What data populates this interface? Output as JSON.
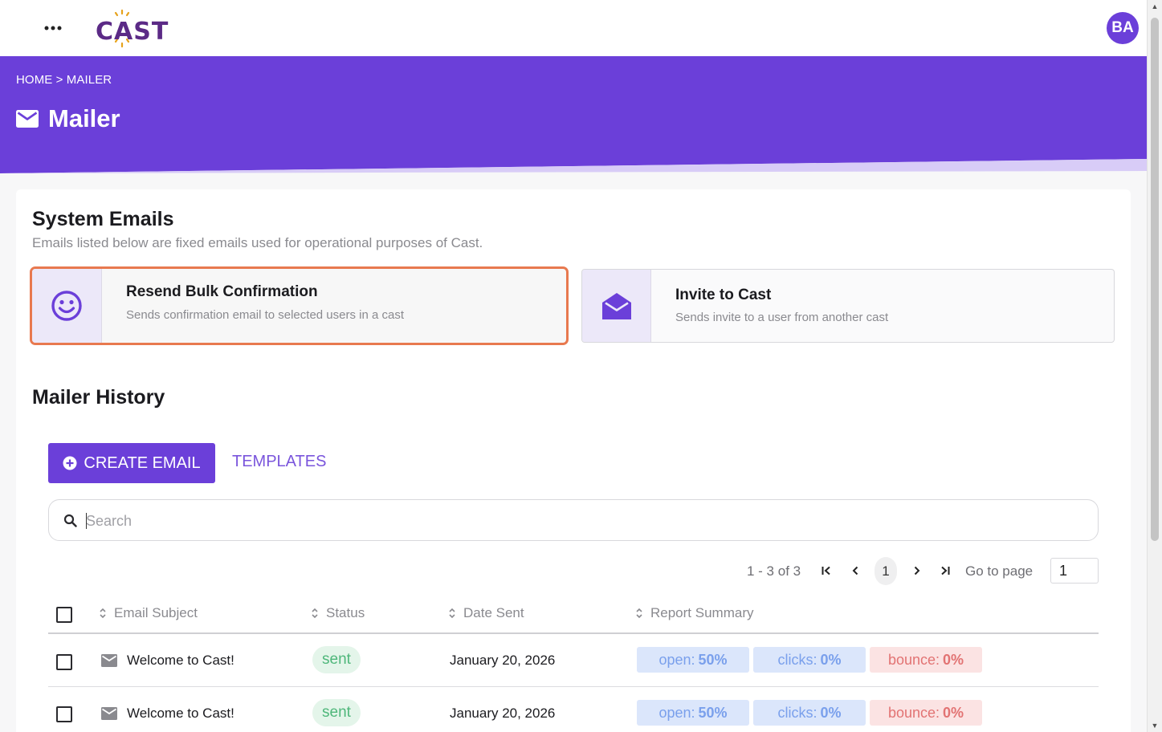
{
  "header": {
    "logo_text": "CAST",
    "avatar_initials": "BA"
  },
  "hero": {
    "breadcrumb": "HOME > MAILER",
    "title": "Mailer"
  },
  "system_emails": {
    "title": "System Emails",
    "subtitle": "Emails listed below are fixed emails used for operational purposes of Cast.",
    "cards": [
      {
        "title": "Resend Bulk Confirmation",
        "description": "Sends confirmation email to selected users in a cast",
        "icon": "smiley-icon"
      },
      {
        "title": "Invite to Cast",
        "description": "Sends invite to a user from another cast",
        "icon": "open-envelope-icon"
      }
    ]
  },
  "history": {
    "title": "Mailer History",
    "create_label": "CREATE EMAIL",
    "templates_label": "TEMPLATES",
    "search_placeholder": "Search",
    "pagination": {
      "range": "1 - 3 of 3",
      "current_page": "1",
      "goto_label": "Go to page",
      "goto_value": "1"
    },
    "columns": [
      "Email Subject",
      "Status",
      "Date Sent",
      "Report Summary"
    ],
    "rows": [
      {
        "subject": "Welcome to Cast!",
        "status": "sent",
        "date": "January 20, 2026",
        "open_label": "open:",
        "open": "50%",
        "clicks_label": "clicks:",
        "clicks": "0%",
        "bounce_label": "bounce:",
        "bounce": "0%"
      },
      {
        "subject": "Welcome to Cast!",
        "status": "sent",
        "date": "January 20, 2026",
        "open_label": "open:",
        "open": "50%",
        "clicks_label": "clicks:",
        "clicks": "0%",
        "bounce_label": "bounce:",
        "bounce": "0%"
      }
    ]
  },
  "colors": {
    "brand_purple": "#6b3fd9",
    "logo_purple": "#5b2a86",
    "focus_orange": "#e8794f",
    "sent_green": "#4fb77b",
    "bounce_red": "#e27373",
    "metric_blue": "#7aa0ec"
  }
}
